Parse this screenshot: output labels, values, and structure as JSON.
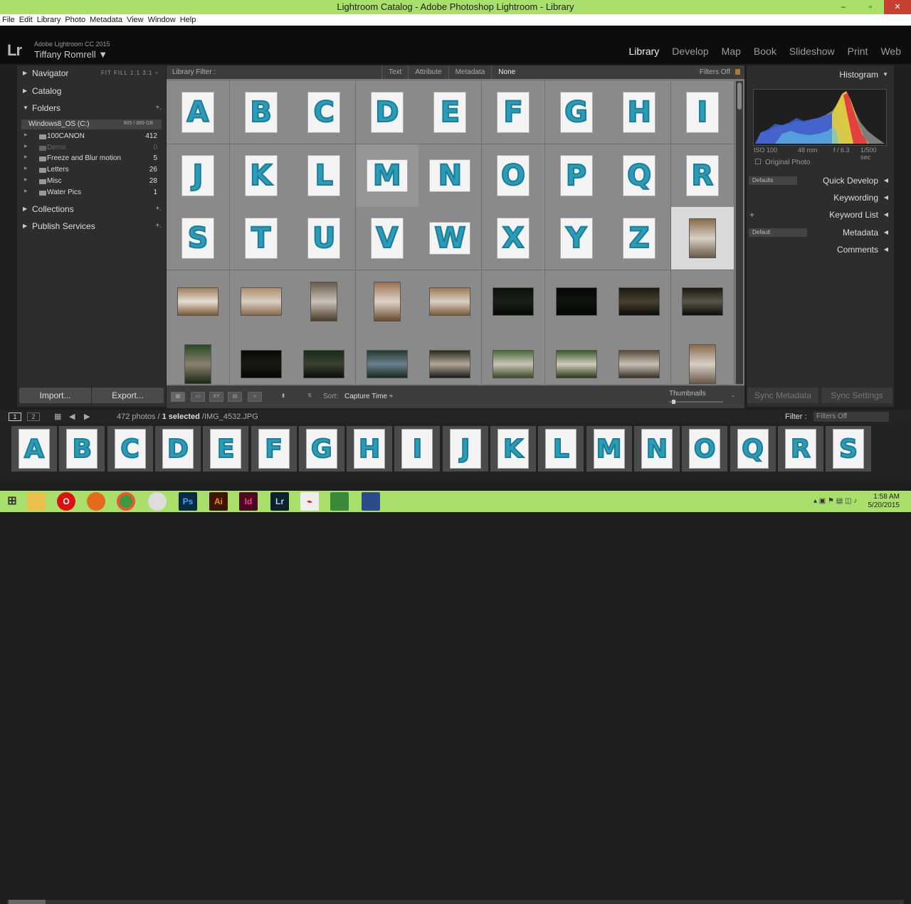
{
  "window": {
    "title": "Lightroom Catalog - Adobe Photoshop Lightroom - Library",
    "controls": [
      "–",
      "▫",
      "✕"
    ]
  },
  "menu": [
    "File",
    "Edit",
    "Library",
    "Photo",
    "Metadata",
    "View",
    "Window",
    "Help"
  ],
  "identity": {
    "logo": "Lr",
    "product": "Adobe Lightroom CC 2015",
    "user": "Tiffany Romrell ▼"
  },
  "modules": {
    "items": [
      "Library",
      "Develop",
      "Map",
      "Book",
      "Slideshow",
      "Print",
      "Web"
    ],
    "active": "Library"
  },
  "left_panel": {
    "navigator": {
      "label": "Navigator",
      "options": "FIT  FILL  1:1  3:1 ÷"
    },
    "catalog": "Catalog",
    "folders": {
      "label": "Folders",
      "drive": {
        "name": "Windows8_OS (C:)",
        "size": "805 / 889 GB"
      },
      "items": [
        {
          "name": "100CANON",
          "count": "412",
          "dim": false
        },
        {
          "name": "Demo",
          "count": "0",
          "dim": true
        },
        {
          "name": "Freeze and Blur motion",
          "count": "5",
          "dim": false
        },
        {
          "name": "Letters",
          "count": "26",
          "dim": false
        },
        {
          "name": "Misc",
          "count": "28",
          "dim": false
        },
        {
          "name": "Water Pics",
          "count": "1",
          "dim": false
        }
      ]
    },
    "collections": "Collections",
    "publish": "Publish Services",
    "import_label": "Import...",
    "export_label": "Export..."
  },
  "filter_bar": {
    "label": "Library Filter :",
    "tabs": [
      "Text",
      "Attribute",
      "Metadata",
      "None"
    ],
    "selected": "None",
    "status": "Filters Off"
  },
  "grid": {
    "letters": [
      "A",
      "B",
      "C",
      "D",
      "E",
      "F",
      "G",
      "H",
      "I",
      "J",
      "K",
      "L",
      "M",
      "N",
      "O",
      "P",
      "Q",
      "R",
      "S",
      "T",
      "U",
      "V",
      "W",
      "X",
      "Y",
      "Z"
    ],
    "selected_index": 26,
    "hover_index": 12
  },
  "toolbar": {
    "sort_label": "Sort:",
    "sort_value": "Capture Time ÷",
    "thumbnails_label": "Thumbnails"
  },
  "right_panel": {
    "histogram": "Histogram",
    "exif": {
      "iso": "ISO 100",
      "focal": "48 mm",
      "aperture": "f / 6.3",
      "shutter": "1/500 sec"
    },
    "original_photo": "Original Photo",
    "quick_develop": {
      "label": "Quick Develop",
      "preset": "Defaults"
    },
    "keywording": "Keywording",
    "keyword_list": "Keyword List",
    "metadata": {
      "label": "Metadata",
      "preset": "Default"
    },
    "comments": "Comments",
    "sync_metadata": "Sync Metadata",
    "sync_settings": "Sync Settings"
  },
  "status_bar": {
    "page1": "1",
    "page2": "2",
    "count": "472 photos /",
    "selected": "1 selected",
    "file": "/IMG_4532.JPG",
    "filter_label": "Filter :",
    "filter_value": "Filters Off"
  },
  "filmstrip": [
    "A",
    "B",
    "C",
    "D",
    "E",
    "F",
    "G",
    "H",
    "I",
    "J",
    "K",
    "L",
    "M",
    "N",
    "O",
    "Q",
    "R",
    "S"
  ],
  "taskbar": {
    "icons": [
      "windows-start",
      "file-explorer",
      "opera",
      "firefox",
      "chrome",
      "snipping-tool",
      "Ps",
      "Ai",
      "Id",
      "Lr",
      "acrobat",
      "excel",
      "app"
    ],
    "time": "1:58 AM",
    "date": "5/20/2015"
  },
  "colors": {
    "title_bar": "#a9e06c",
    "letter_blue": "#2a9cb8",
    "panel_bg": "#2d2d2d",
    "grid_bg": "#8a8a8a"
  }
}
